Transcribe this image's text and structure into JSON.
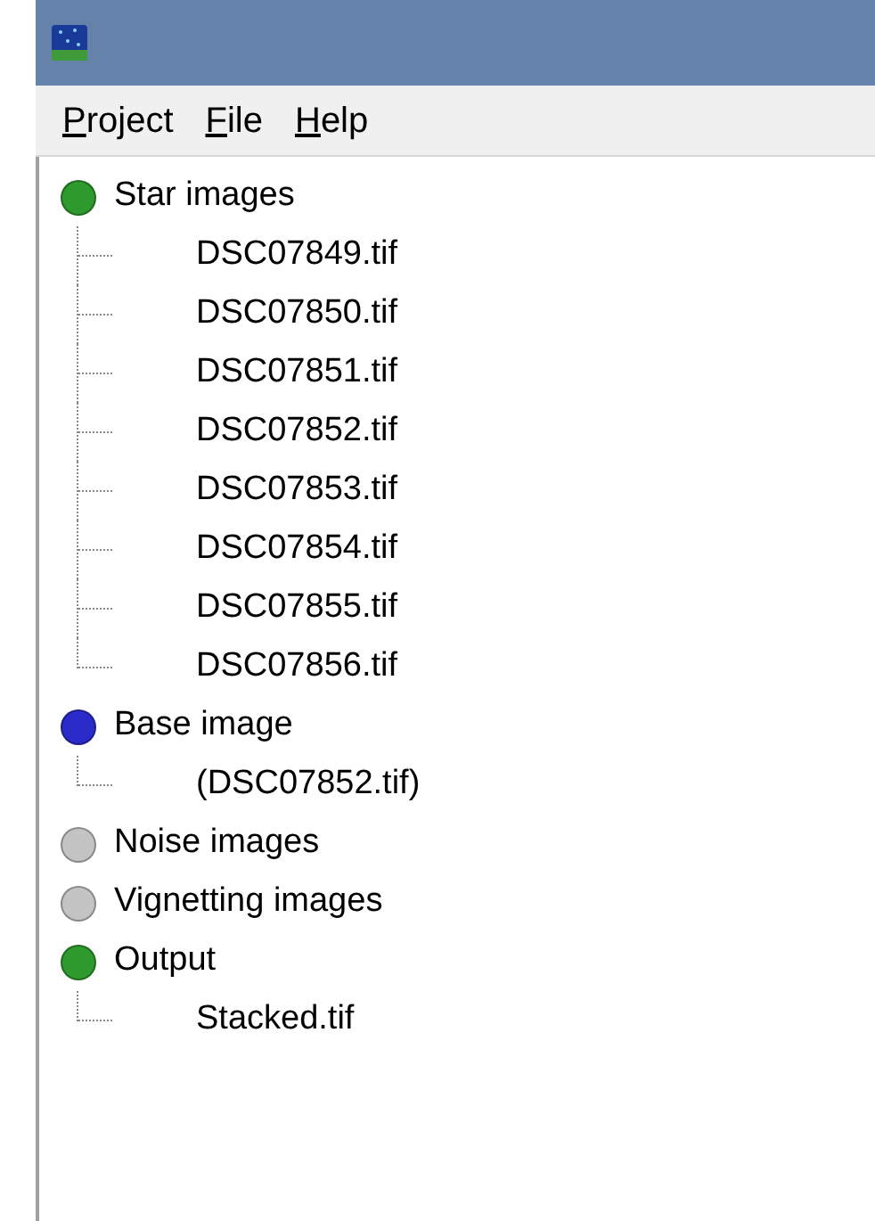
{
  "menu": [
    {
      "label": "Project",
      "mnemonic_first": true
    },
    {
      "label": "File",
      "mnemonic_first": true
    },
    {
      "label": "Help",
      "mnemonic_first": true
    }
  ],
  "tree": [
    {
      "label": "Star images",
      "color": "#2e9a2e",
      "children": [
        {
          "label": "DSC07849.tif"
        },
        {
          "label": "DSC07850.tif"
        },
        {
          "label": "DSC07851.tif"
        },
        {
          "label": "DSC07852.tif"
        },
        {
          "label": "DSC07853.tif"
        },
        {
          "label": "DSC07854.tif"
        },
        {
          "label": "DSC07855.tif"
        },
        {
          "label": "DSC07856.tif"
        }
      ]
    },
    {
      "label": "Base image",
      "color": "#2a2ac8",
      "children": [
        {
          "label": "(DSC07852.tif)"
        }
      ]
    },
    {
      "label": "Noise images",
      "color": "#c4c4c4"
    },
    {
      "label": "Vignetting images",
      "color": "#c4c4c4"
    },
    {
      "label": "Output",
      "color": "#2e9a2e",
      "children": [
        {
          "label": "Stacked.tif"
        }
      ]
    }
  ]
}
